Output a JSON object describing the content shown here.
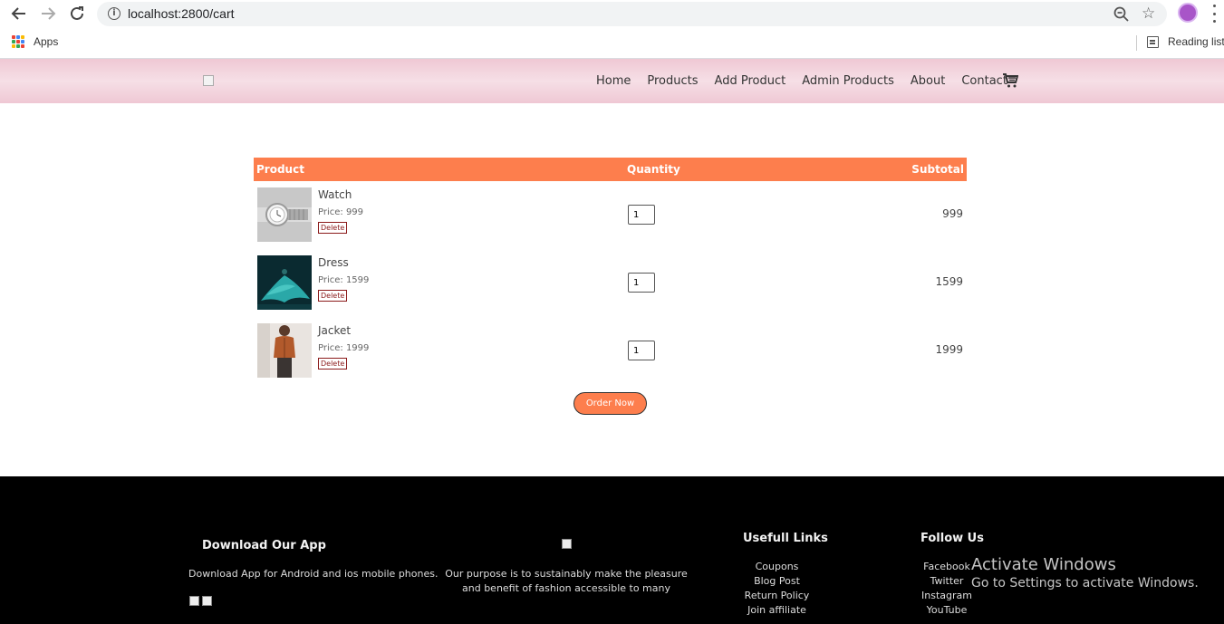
{
  "browser": {
    "url": "localhost:2800/cart",
    "apps_label": "Apps",
    "reading_list_label": "Reading list",
    "icons": [
      "back-arrow-icon",
      "forward-arrow-icon",
      "reload-icon",
      "info-icon",
      "zoom-icon",
      "star-icon",
      "profile-avatar",
      "menu-dots-icon",
      "apps-grid-icon",
      "reading-list-icon"
    ]
  },
  "header": {
    "nav": [
      "Home",
      "Products",
      "Add Product",
      "Admin Products",
      "About",
      "Contact"
    ],
    "cart_icon": "cart-icon",
    "background_colors": [
      "#efc8d4",
      "#f6dfe6"
    ]
  },
  "cart": {
    "columns": {
      "product": "Product",
      "quantity": "Quantity",
      "subtotal": "Subtotal"
    },
    "header_color": "#fd7e4d",
    "items": [
      {
        "name": "Watch",
        "price": "Price: 999",
        "delete_label": "Delete",
        "quantity": "1",
        "subtotal": "999"
      },
      {
        "name": "Dress",
        "price": "Price: 1599",
        "delete_label": "Delete",
        "quantity": "1",
        "subtotal": "1599"
      },
      {
        "name": "Jacket",
        "price": "Price: 1999",
        "delete_label": "Delete",
        "quantity": "1",
        "subtotal": "1999"
      }
    ],
    "order_button": "Order Now"
  },
  "footer": {
    "download": {
      "title": "Download Our App",
      "text": "Download App for Android and ios mobile phones."
    },
    "about": {
      "line1": "Our purpose is to sustainably make the pleasure",
      "line2": "and benefit of fashion accessible to many"
    },
    "useful_links": {
      "title": "Usefull Links",
      "items": [
        "Coupons",
        "Blog Post",
        "Return Policy",
        "Join affiliate"
      ]
    },
    "follow": {
      "title": "Follow Us",
      "items": [
        "Facebook",
        "Twitter",
        "Instagram",
        "YouTube"
      ]
    }
  },
  "watermark": {
    "line1": "Activate Windows",
    "line2": "Go to Settings to activate Windows."
  }
}
